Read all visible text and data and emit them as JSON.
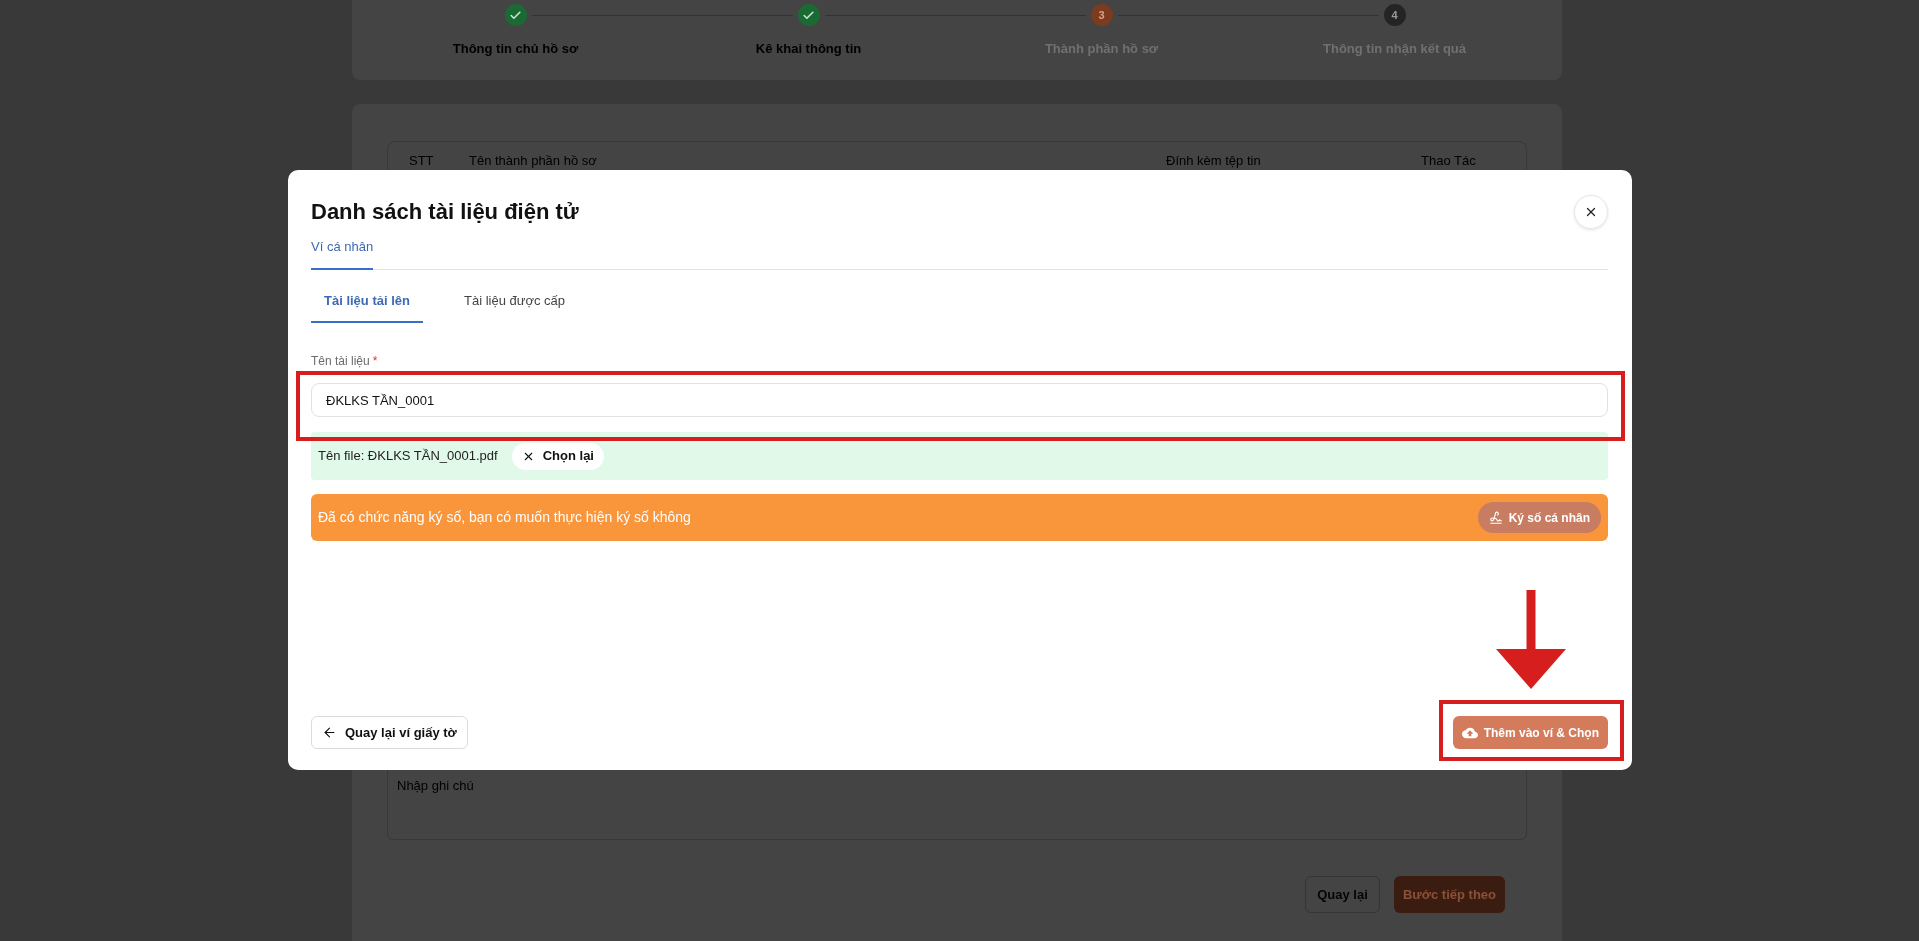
{
  "stepper": {
    "steps": [
      {
        "label": "Thông tin chủ hồ sơ",
        "kind": "done"
      },
      {
        "label": "Kê khai thông tin",
        "kind": "done"
      },
      {
        "label": "Thành phần hồ sơ",
        "number": "3",
        "kind": "current"
      },
      {
        "label": "Thông tin nhận kết quả",
        "number": "4",
        "kind": "upcoming"
      }
    ]
  },
  "table": {
    "columns": [
      "STT",
      "Tên thành phần hồ sơ",
      "Đính kèm tệp tin",
      "Thao Tác"
    ]
  },
  "note_field": {
    "placeholder": "Nhập ghi chú"
  },
  "page_buttons": [
    {
      "label": "Quay lại",
      "kind": "secondary"
    },
    {
      "label": "Bước tiếp theo",
      "kind": "primary"
    }
  ],
  "dialog": {
    "title": "Danh sách tài liệu điện tử",
    "tabs": [
      {
        "label": "Ví cá nhân",
        "selected": true
      }
    ],
    "subtabs": [
      {
        "label": "Tài liệu tải lên",
        "selected": true
      },
      {
        "label": "Tài liệu được cấp",
        "selected": false
      }
    ],
    "name_field": {
      "label": "Tên tài liệu",
      "required_mark": "*",
      "value": "ĐKLKS TẦN_0001",
      "highlighted": true
    },
    "file": {
      "name": "Tên file: ĐKLKS TẦN_0001.pdf",
      "reselect_button": "Chọn lại"
    },
    "sign_banner": {
      "message": "Đã có chức năng ký số, bạn có muốn thực hiện ký số không",
      "button": "Ký số cá nhân"
    },
    "back_button": "Quay lại ví giấy tờ",
    "confirm_button": {
      "label": "Thêm vào ví & Chọn",
      "highlighted": true,
      "arrow": true
    }
  }
}
